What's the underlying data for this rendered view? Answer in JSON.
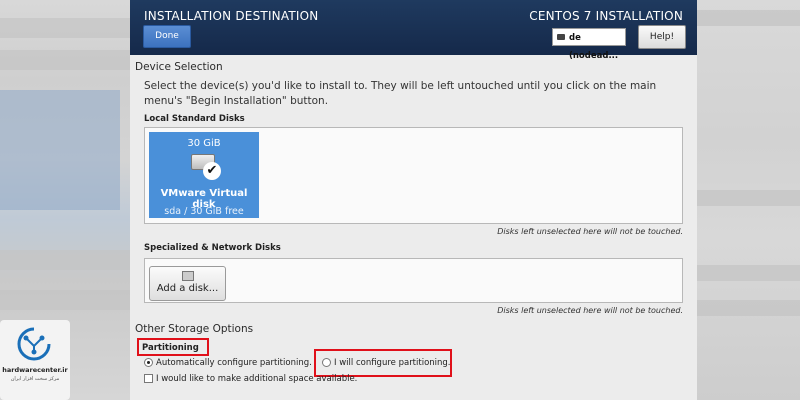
{
  "header": {
    "title": "INSTALLATION DESTINATION",
    "product": "CENTOS 7 INSTALLATION",
    "done_label": "Done",
    "keyboard_layout": "de (nodead...",
    "help_label": "Help!"
  },
  "device_selection": {
    "title": "Device Selection",
    "description": "Select the device(s) you'd like to install to.  They will be left untouched until you click on the main menu's \"Begin Installation\" button.",
    "local_label": "Local Standard Disks",
    "disk": {
      "size": "30 GiB",
      "name": "VMware Virtual disk",
      "info": "sda   /   30 GiB free",
      "selected": true
    },
    "local_hint": "Disks left unselected here will not be touched.",
    "network_label": "Specialized & Network Disks",
    "add_disk_label": "Add a disk...",
    "network_hint": "Disks left unselected here will not be touched."
  },
  "other_storage": {
    "title": "Other Storage Options",
    "partitioning_label": "Partitioning",
    "auto_label": "Automatically configure partitioning.",
    "manual_label": "I will configure partitioning.",
    "space_label": "I would like to make additional space available.",
    "auto_selected": true
  },
  "watermark": {
    "name": "hardwarecenter.ir",
    "subtitle": "مرکز سخت افزار ایران"
  },
  "colors": {
    "header_bg": "#15294a",
    "accent": "#4a90d9",
    "highlight_box": "#e0101a"
  }
}
